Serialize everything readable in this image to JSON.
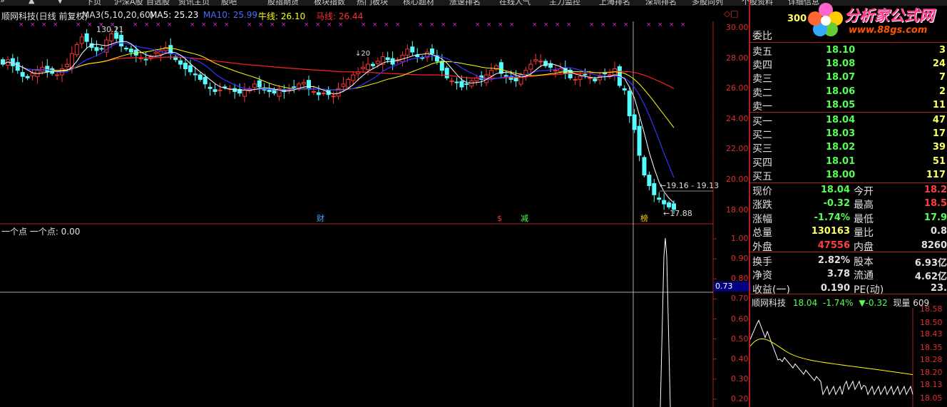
{
  "toolbar": {
    "items": [
      "»",
      "▲",
      "▼",
      "下页",
      "沪深A股",
      "自选股",
      "资讯主页",
      "股吧",
      "股指期货",
      "板块指数",
      "热门板块",
      "核心题材",
      "涨速排名",
      "在线人气",
      "主力监控",
      "上海排名",
      "深圳排名",
      "多股同列",
      "个股资料",
      "详细信息"
    ]
  },
  "header": {
    "title": "顺网科技(日线 前复权)",
    "ma3_label": "MA3(5,10,20,60)",
    "ma5": "MA5: 25.23",
    "ma10": "MA10: 25.99",
    "niu": "牛线: 26.10",
    "ma_line": "马线: 26.44"
  },
  "colors": {
    "up": "#ff3333",
    "down": "#55ffff",
    "ma_white": "#ffffff",
    "ma_yellow": "#ffff00",
    "ma_blue": "#3333ff",
    "ma_red": "#ff2020",
    "axis": "#b02020"
  },
  "main_chart": {
    "y_ticks": [
      "30.00",
      "28.00",
      "26.00",
      "24.00",
      "22.00",
      "20.00",
      "18.00"
    ],
    "high_annotation": "130.21",
    "recent_high_annotation": "←19.16 - 19.13",
    "low_annotation": "←17.88",
    "mid_annotation": "↓20",
    "event_markers": [
      "财",
      "$",
      "减",
      "榜"
    ]
  },
  "sub_chart": {
    "title": "一个点  一个点: 0.00",
    "y_ticks": [
      "1.00",
      "0.90",
      "0.80",
      "0.70",
      "0.60",
      "0.50",
      "0.40",
      "0.30",
      "0.20"
    ],
    "cursor_value": "0.73",
    "series": [
      0,
      0,
      0,
      0,
      0,
      0,
      0,
      0,
      0,
      0,
      0,
      0,
      1,
      0,
      0
    ]
  },
  "quote": {
    "corner_value": "300",
    "weibi_label": "委比",
    "asks": [
      {
        "label": "卖五",
        "price": "18.10",
        "vol": "3"
      },
      {
        "label": "卖四",
        "price": "18.08",
        "vol": "24"
      },
      {
        "label": "卖三",
        "price": "18.07",
        "vol": "7"
      },
      {
        "label": "卖二",
        "price": "18.06",
        "vol": "2"
      },
      {
        "label": "卖一",
        "price": "18.05",
        "vol": "11"
      }
    ],
    "bids": [
      {
        "label": "买一",
        "price": "18.04",
        "vol": "47"
      },
      {
        "label": "买二",
        "price": "18.03",
        "vol": "17"
      },
      {
        "label": "买三",
        "price": "18.02",
        "vol": "39"
      },
      {
        "label": "买四",
        "price": "18.01",
        "vol": "51"
      },
      {
        "label": "买五",
        "price": "18.00",
        "vol": "117"
      }
    ],
    "stats": [
      {
        "l1": "现价",
        "v1": "18.04",
        "l2": "今开",
        "v2": "18.2"
      },
      {
        "l1": "涨跌",
        "v1": "-0.32",
        "l2": "最高",
        "v2": "18.5"
      },
      {
        "l1": "涨幅",
        "v1": "-1.74%",
        "l2": "最低",
        "v2": "17.9"
      },
      {
        "l1": "总量",
        "v1": "130163",
        "l2": "量比",
        "v2": "0.8"
      },
      {
        "l1": "外盘",
        "v1": "47556",
        "l2": "内盘",
        "v2": "8260"
      },
      {
        "l1": "换手",
        "v1": "2.82%",
        "l2": "股本",
        "v2": "6.93亿"
      },
      {
        "l1": "净资",
        "v1": "3.78",
        "l2": "流通",
        "v2": "4.62亿"
      },
      {
        "l1": "收益(一)",
        "v1": "0.190",
        "l2": "PE(动)",
        "v2": "23."
      }
    ]
  },
  "intraday": {
    "title": "顺网科技",
    "price": "18.04",
    "change_pct": "-1.74%",
    "change": "▼-0.32",
    "current_vol": "现量 609",
    "y_ticks": [
      "18.58",
      "18.50",
      "18.43",
      "18.35",
      "18.28",
      "18.20",
      "18.13",
      "18.05"
    ]
  },
  "watermark": {
    "title": "分析家公式网",
    "url": "www.88gs.com"
  }
}
